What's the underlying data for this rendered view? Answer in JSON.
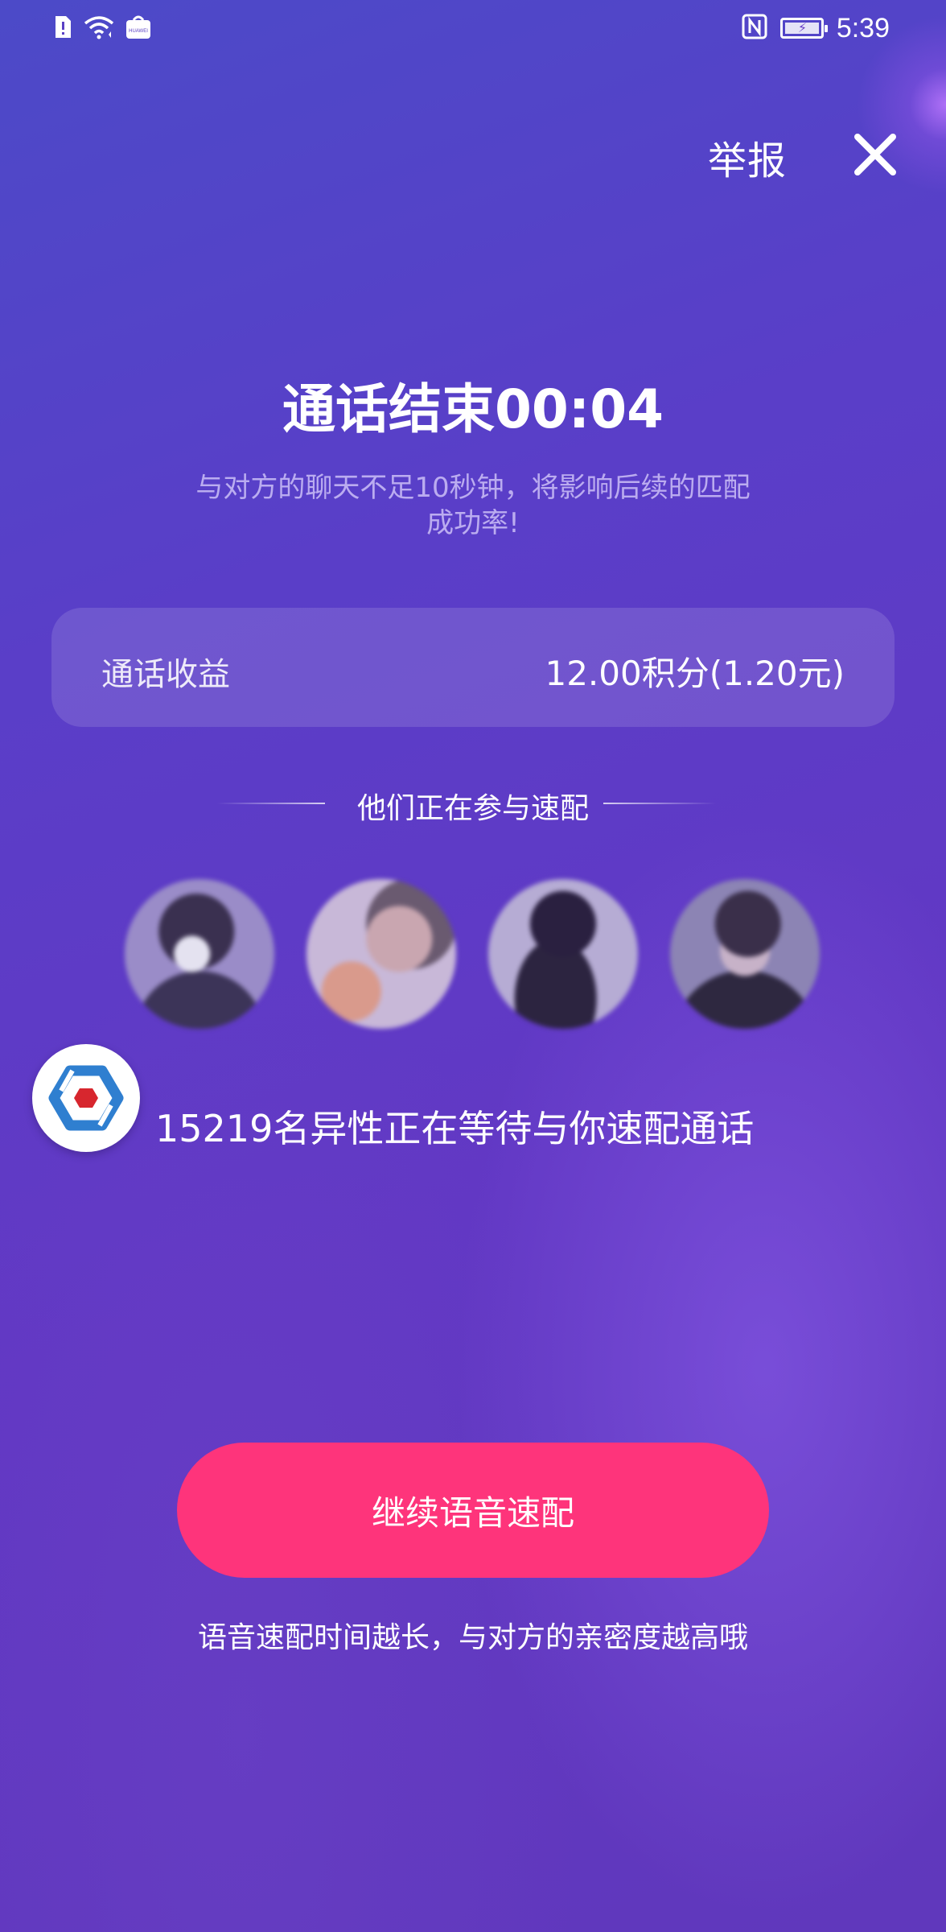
{
  "status_bar": {
    "time": "5:39",
    "icons": [
      "sim-alert-icon",
      "wifi-icon",
      "huawei-app-icon",
      "nfc-icon",
      "battery-charging-icon"
    ],
    "huawei_label": "HUAWEI"
  },
  "header": {
    "report_label": "举报",
    "close_icon": "close-icon"
  },
  "call_summary": {
    "title": "通话结束00:04",
    "subtitle": "与对方的聊天不足10秒钟，将影响后续的匹配成功率!"
  },
  "earnings": {
    "label": "通话收益",
    "value": "12.00积分(1.20元)"
  },
  "participants": {
    "section_title": "他们正在参与速配",
    "avatars": [
      "avatar-1",
      "avatar-2",
      "avatar-3",
      "avatar-4"
    ]
  },
  "waiting": {
    "text": "15219名异性正在等待与你速配通话",
    "badge_icon": "hexagon-logo-icon"
  },
  "cta": {
    "label": "继续语音速配",
    "hint": "语音速配时间越长，与对方的亲密度越高哦"
  },
  "colors": {
    "background": "#5b3dc6",
    "cta": "#fe347b",
    "badge_blue": "#2f7fd0",
    "badge_red": "#d7262e"
  }
}
